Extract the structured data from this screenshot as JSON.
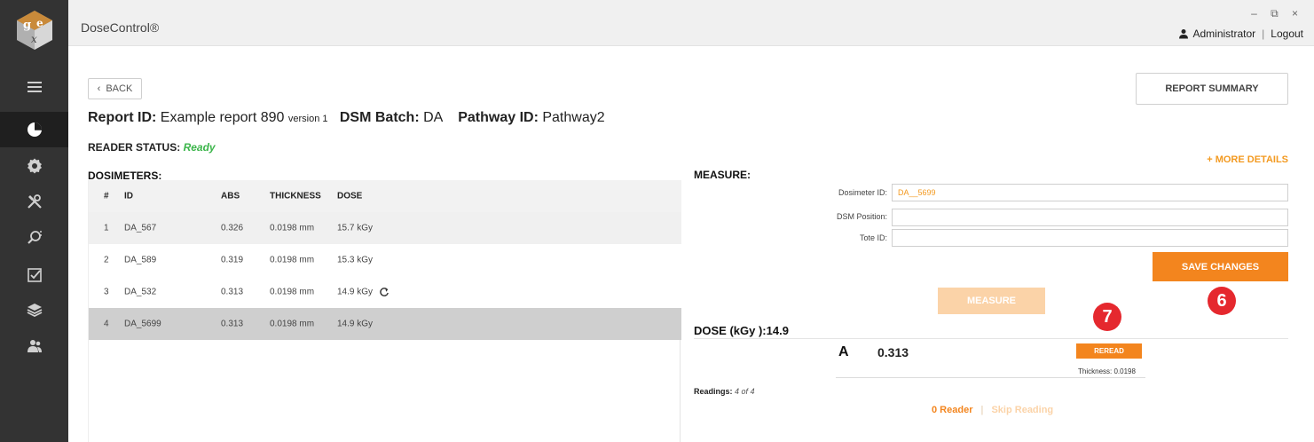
{
  "app": {
    "title": "DoseControl®",
    "window_controls": "– ⧉ ×",
    "user_name": "Administrator",
    "logout_label": "Logout",
    "user_separator": "|"
  },
  "sidebar": {
    "logo_letters": "gex",
    "items": [
      {
        "icon": "menu-icon"
      },
      {
        "icon": "pie-chart-icon",
        "active": true
      },
      {
        "icon": "gear-icon"
      },
      {
        "icon": "tools-icon"
      },
      {
        "icon": "search-icon"
      },
      {
        "icon": "checklist-icon"
      },
      {
        "icon": "layers-icon"
      },
      {
        "icon": "users-icon"
      }
    ]
  },
  "header": {
    "back_label": "BACK",
    "report_summary_label": "REPORT SUMMARY",
    "report_id_label": "Report ID:",
    "report_id_value": "Example report 890",
    "report_version": "version 1",
    "dsm_batch_label": "DSM Batch:",
    "dsm_batch_value": "DA",
    "pathway_label": "Pathway ID:",
    "pathway_value": "Pathway2",
    "reader_status_label": "READER STATUS:",
    "reader_status_value": "Ready",
    "more_details_label": "+ MORE DETAILS"
  },
  "dosimeters": {
    "title": "DOSIMETERS:",
    "columns": [
      "#",
      "ID",
      "ABS",
      "THICKNESS",
      "DOSE"
    ],
    "rows": [
      {
        "num": "1",
        "id": "DA_567",
        "abs": "0.326",
        "thickness": "0.0198 mm",
        "dose": "15.7  kGy",
        "reload": false,
        "selected": false
      },
      {
        "num": "2",
        "id": "DA_589",
        "abs": "0.319",
        "thickness": "0.0198 mm",
        "dose": "15.3  kGy",
        "reload": false,
        "selected": false
      },
      {
        "num": "3",
        "id": "DA_532",
        "abs": "0.313",
        "thickness": "0.0198 mm",
        "dose": "14.9  kGy",
        "reload": true,
        "selected": false
      },
      {
        "num": "4",
        "id": "DA_5699",
        "abs": "0.313",
        "thickness": "0.0198 mm",
        "dose": "14.9  kGy",
        "reload": false,
        "selected": true
      }
    ]
  },
  "measure": {
    "title": "MEASURE:",
    "dosimeter_id_label": "Dosimeter ID:",
    "dosimeter_id_value": "DA__5699",
    "dsm_position_label": "DSM Position:",
    "dsm_position_value": "",
    "tote_id_label": "Tote ID:",
    "tote_id_value": "",
    "save_label": "SAVE CHANGES",
    "measure_label": "MEASURE",
    "badge_save": "6",
    "badge_reread": "7",
    "dose_label": "DOSE (kGy ):14.9",
    "reading_letter": "A",
    "reading_value": "0.313",
    "reread_label": "REREAD",
    "thickness_text": "Thickness: 0.0198",
    "readings_label": "Readings:",
    "readings_value": "4  of  4",
    "reader_link": "0 Reader",
    "link_separator": "|",
    "skip_link": "Skip Reading"
  },
  "colors": {
    "sidebar": "#333333",
    "accent": "#f3851e",
    "accent_disabled": "#fbd3a8",
    "ready": "#3bb54a",
    "badge": "#e5282e"
  }
}
